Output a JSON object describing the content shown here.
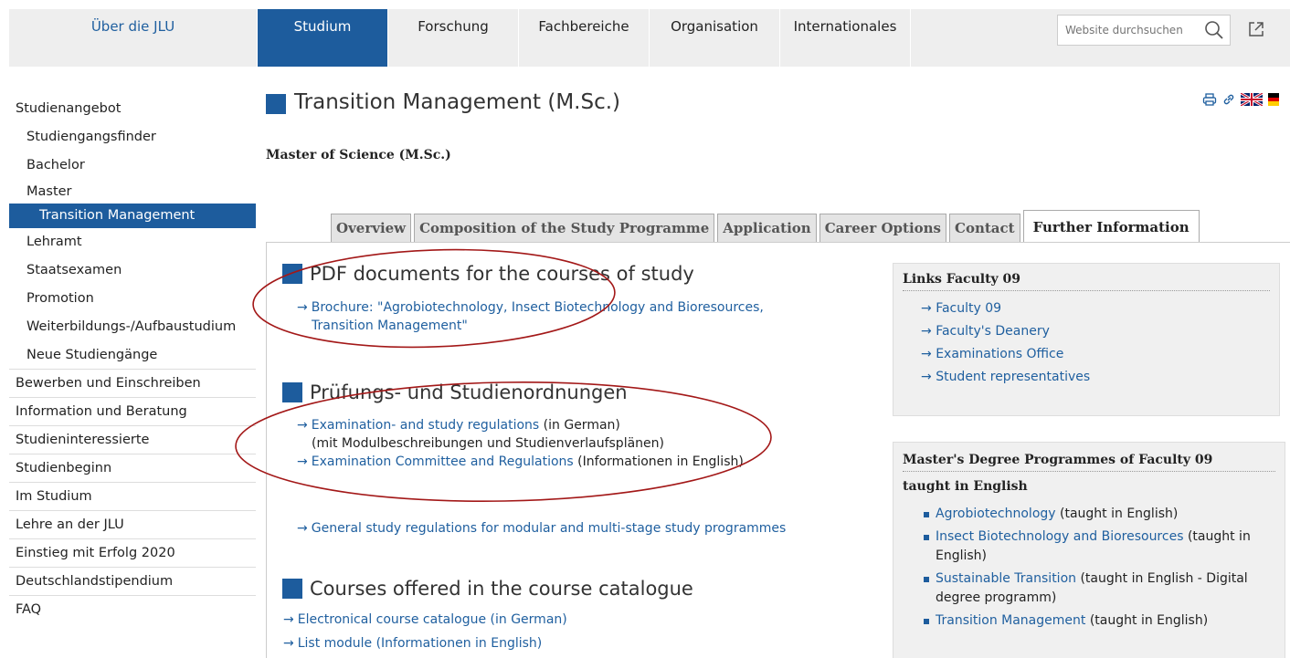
{
  "topnav": {
    "brand": "Über die JLU",
    "items": [
      "Studium",
      "Forschung",
      "Fachbereiche",
      "Organisation",
      "Internationales"
    ],
    "active": "Studium",
    "search_placeholder": "Website durchsuchen"
  },
  "sidebar": {
    "items": [
      {
        "label": "Studienangebot",
        "level": 0
      },
      {
        "label": "Studiengangsfinder",
        "level": 1
      },
      {
        "label": "Bachelor",
        "level": 1
      },
      {
        "label": "Master",
        "level": 1
      },
      {
        "label": "Transition Management",
        "level": 2,
        "selected": true
      },
      {
        "label": "Lehramt",
        "level": 1
      },
      {
        "label": "Staatsexamen",
        "level": 1
      },
      {
        "label": "Promotion",
        "level": 1
      },
      {
        "label": "Weiterbildungs-/Aufbaustudium",
        "level": 1
      },
      {
        "label": "Neue Studiengänge",
        "level": 1
      },
      {
        "label": "Bewerben und Einschreiben",
        "level": 0
      },
      {
        "label": "Information und Beratung",
        "level": 0
      },
      {
        "label": "Studieninteressierte",
        "level": 0
      },
      {
        "label": "Studienbeginn",
        "level": 0
      },
      {
        "label": "Im Studium",
        "level": 0
      },
      {
        "label": "Lehre an der JLU",
        "level": 0
      },
      {
        "label": "Einstieg mit Erfolg 2020",
        "level": 0
      },
      {
        "label": "Deutschlandstipendium",
        "level": 0
      },
      {
        "label": "FAQ",
        "level": 0
      }
    ]
  },
  "main": {
    "title": "Transition Management (M.Sc.)",
    "subtitle": "Master of Science (M.Sc.)",
    "tabs": [
      "Overview",
      "Composition of the Study Programme",
      "Application",
      "Career Options",
      "Contact",
      "Further Information"
    ],
    "active_tab": "Further Information",
    "sections": {
      "pdf": {
        "title": "PDF documents for the courses of study",
        "brochure_line1": "Brochure: \"Agrobiotechnology, Insect Biotechnology and Bioresources,",
        "brochure_line2": "Transition Management\""
      },
      "regs": {
        "title": "Prüfungs- und Studienordnungen",
        "exam_link": "Examination- and study regulations",
        "exam_note": " (in German)",
        "exam_sub": "(mit Modulbeschreibungen und Studienverlaufsplänen)",
        "committee_link": "Examination Committee and Regulations",
        "committee_note": " (Informationen in English)",
        "general_link": "General study regulations for modular and multi-stage study programmes"
      },
      "courses": {
        "title": "Courses offered in the course catalogue",
        "catalogue_link": "Electronical course catalogue (in German)",
        "module_link": "List module (Informationen in English)"
      }
    }
  },
  "links_box": {
    "title": "Links Faculty 09",
    "items": [
      "Faculty 09",
      "Faculty's Deanery",
      "Examinations Office",
      "Student representatives"
    ]
  },
  "masters_box": {
    "title_line1": "Master's Degree Programmes of Faculty 09",
    "title_line2": "taught in English",
    "items": [
      {
        "link": "Agrobiotechnology",
        "note": " (taught in English)"
      },
      {
        "link": "Insect Biotechnology and Bioresources",
        "note": " (taught in English)"
      },
      {
        "link": "Sustainable Transition",
        "note": " (taught in English - Digital degree programm)"
      },
      {
        "link": "Transition Management",
        "note": " (taught in English)"
      }
    ]
  },
  "arrow_glyph": "→",
  "colors": {
    "accent": "#1d5c9d",
    "link": "#1f5f9f",
    "annotation": "#a31818"
  }
}
